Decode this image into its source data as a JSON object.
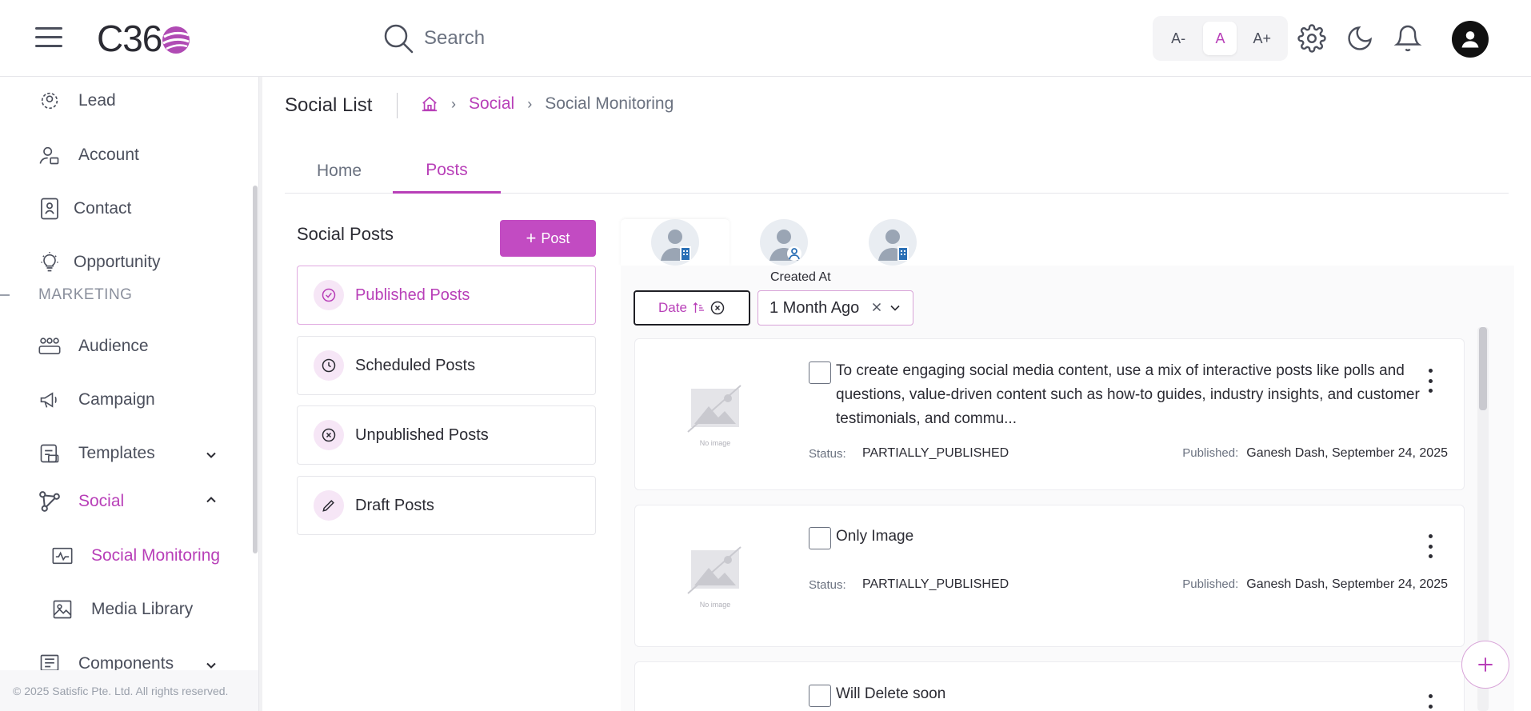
{
  "header": {
    "logo_text": "C36",
    "search_placeholder": "Search",
    "font_controls": [
      "A-",
      "A",
      "A+"
    ],
    "font_active": "A",
    "icons": [
      "menu-icon",
      "search-icon",
      "gear-icon",
      "moon-icon",
      "bell-icon",
      "user-avatar-icon"
    ]
  },
  "sidebar": {
    "items": [
      {
        "label": "Lead",
        "icon": "lead-icon"
      },
      {
        "label": "Account",
        "icon": "account-icon"
      },
      {
        "label": "Contact",
        "icon": "contact-icon"
      },
      {
        "label": "Opportunity",
        "icon": "lightbulb-icon"
      }
    ],
    "section_marketing": "MARKETING",
    "marketing_items": [
      {
        "label": "Audience",
        "icon": "audience-icon"
      },
      {
        "label": "Campaign",
        "icon": "megaphone-icon"
      },
      {
        "label": "Templates",
        "icon": "templates-icon"
      },
      {
        "label": "Social",
        "icon": "social-icon"
      }
    ],
    "social_children": [
      {
        "label": "Social Monitoring",
        "icon": "monitor-icon"
      },
      {
        "label": "Media Library",
        "icon": "image-icon"
      }
    ],
    "components_label": "Components",
    "copyright": "© 2025 Satisfic Pte. Ltd. All rights reserved."
  },
  "page": {
    "title": "Social List",
    "breadcrumb": [
      "Social",
      "Social Monitoring"
    ],
    "tabs": [
      "Home",
      "Posts"
    ],
    "active_tab": "Posts"
  },
  "social_posts": {
    "title": "Social Posts",
    "new_post_label": "Post",
    "filters": [
      {
        "label": "Published Posts",
        "icon": "check-circle-icon"
      },
      {
        "label": "Scheduled Posts",
        "icon": "clock-icon"
      },
      {
        "label": "Unpublished Posts",
        "icon": "x-circle-icon"
      },
      {
        "label": "Draft Posts",
        "icon": "pencil-icon"
      }
    ],
    "active_filter": "Published Posts"
  },
  "posts_panel": {
    "created_at_label": "Created At",
    "date_sort_label": "Date",
    "range_value": "1 Month Ago",
    "no_image_label": "No image",
    "status_label": "Status:",
    "published_label": "Published:",
    "posts": [
      {
        "text": "To create engaging social media content, use a mix of interactive posts like polls and questions, value-driven content such as how-to guides, industry insights, and customer testimonials, and commu...",
        "status": "PARTIALLY_PUBLISHED",
        "published": "Ganesh Dash, September 24, 2025"
      },
      {
        "text": "Only Image",
        "status": "PARTIALLY_PUBLISHED",
        "published": "Ganesh Dash, September 24, 2025"
      },
      {
        "text": "Will Delete soon",
        "status": "",
        "published": ""
      }
    ]
  },
  "colors": {
    "accent": "#b83fb8",
    "text": "#2b2b33",
    "muted": "#6b7280"
  }
}
